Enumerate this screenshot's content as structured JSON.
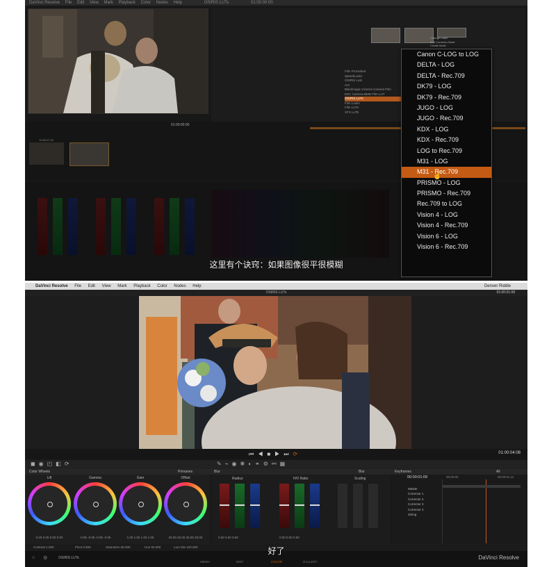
{
  "top": {
    "mac_menu": [
      "DaVinci Resolve",
      "File",
      "Edit",
      "View",
      "Mark",
      "Playback",
      "Color",
      "Nodes",
      "Help"
    ],
    "project": "OSIRIS LUTs",
    "timecode_top": "01:00:00:00",
    "timecode_transport": "01:00:00:00",
    "clip_tc": "14:50:07:22",
    "submenu_items": [
      "Film Procedure",
      "SpeedLooks",
      "OSIRIS Luts",
      "Arri",
      "Blackmagic Cinema Camera Film",
      "DSC Camera BMD Film LUT",
      "OSIRIS LUTs",
      "Film Looks",
      "Film LUTs",
      "VFX LUTs"
    ],
    "lut_menu_items": [
      "Canon C-LOG to LOG",
      "DELTA - LOG",
      "DELTA - Rec.709",
      "DK79 - LOG",
      "DK79 - Rec.709",
      "JUGO - LOG",
      "JUGO - Rec.709",
      "KDX - LOG",
      "KDX - Rec.709",
      "LOG to Rec.709",
      "M31 - LOG",
      "M31 - Rec.709",
      "PRISMO - LOG",
      "PRISMO - Rec.709",
      "Rec.709 to LOG",
      "Vision 4 - LOG",
      "Vision 4 - Rec.709",
      "Vision 6 - LOG",
      "Vision 6 - Rec.709"
    ],
    "selected_item": "M31 - Rec.709",
    "context_items": [
      "Change Label",
      "Add Corrector Node",
      "Create Node"
    ],
    "subtitle": "这里有个诀窍：如果图像很平很模糊"
  },
  "bottom": {
    "menu": {
      "app": "DaVinci Resolve",
      "items": [
        "File",
        "Edit",
        "View",
        "Mark",
        "Playback",
        "Color",
        "Nodes",
        "Help"
      ],
      "user": "Denver Riddle"
    },
    "project": "OSIRIS LUTs",
    "timecode_top": "01:00:01:08",
    "timecode_transport": "01:00:04:08",
    "section_labels": {
      "color_wheels": "Color Wheels",
      "primaries": "Primaries",
      "blur": "Blur",
      "blur_mode": "Blur",
      "keyframes": "Keyframes",
      "keyframes_mode": "All"
    },
    "wheels": [
      {
        "label": "Lift",
        "values": "0.00   0.00   0.00   0.00"
      },
      {
        "label": "Gamma",
        "values": "-0.05  -0.05  -0.05  -0.05"
      },
      {
        "label": "Gain",
        "values": "1.00   1.00   1.00   1.00"
      },
      {
        "label": "Offset",
        "values": "25.00  25.00  25.00  25.00"
      }
    ],
    "blur_labels": {
      "radius": "Radius",
      "hv_ratio": "H/V Ratio",
      "scaling": "Scaling"
    },
    "blur_values": {
      "radius": "0.50   0.50   0.50",
      "hv_ratio": "0.50   0.50   0.50"
    },
    "keyframe_tc": "00:00:01:09",
    "keyframe_tc2": "00:00:00",
    "keyframe_tc3": "00:00:01:11",
    "keyframe_rows": [
      "Master",
      "Corrector 1",
      "Corrector 2",
      "Corrector 3",
      "Corrector 4",
      "Sizing"
    ],
    "bottom_values": {
      "contrast": "Contrast  1.000",
      "pivot": "Pivot  0.500",
      "saturation": "Saturation  50.000",
      "hue": "Hue  50.000",
      "lum_mix": "Lum Mix  100.000"
    },
    "pages": [
      "MEDIA",
      "EDIT",
      "COLOR",
      "GALLERY"
    ],
    "project_bottom": "OSIRIS LUTs",
    "brand": "DaVinci Resolve",
    "subtitle": "好了",
    "colors": {
      "accent": "#c45b14",
      "selection": "#b4591e"
    }
  }
}
